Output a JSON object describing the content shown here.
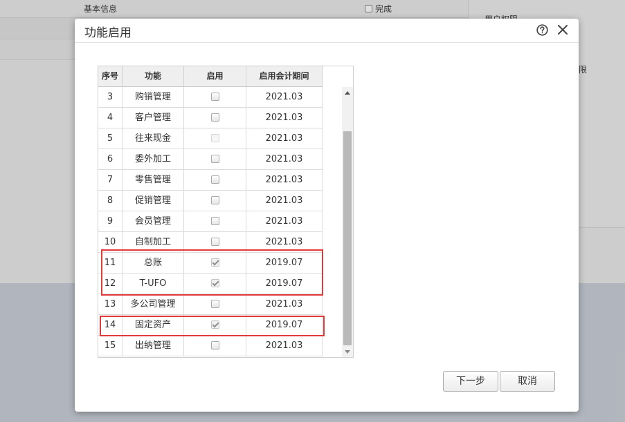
{
  "background": {
    "basic_info_label": "基本信息",
    "done_label": "完成",
    "user_perm_label": "用户权限",
    "fragment_label": "限"
  },
  "dialog": {
    "title": "功能启用",
    "help_icon": "help-circle-icon",
    "close_icon": "close-icon"
  },
  "grid": {
    "columns": [
      "序号",
      "功能",
      "启用",
      "启用会计期间"
    ],
    "rows": [
      {
        "no": "3",
        "function": "购销管理",
        "enabled": false,
        "disabled": false,
        "period": "2021.03"
      },
      {
        "no": "4",
        "function": "客户管理",
        "enabled": false,
        "disabled": false,
        "period": "2021.03"
      },
      {
        "no": "5",
        "function": "往来现金",
        "enabled": false,
        "disabled": true,
        "period": "2021.03"
      },
      {
        "no": "6",
        "function": "委外加工",
        "enabled": false,
        "disabled": false,
        "period": "2021.03"
      },
      {
        "no": "7",
        "function": "零售管理",
        "enabled": false,
        "disabled": false,
        "period": "2021.03"
      },
      {
        "no": "8",
        "function": "促销管理",
        "enabled": false,
        "disabled": false,
        "period": "2021.03"
      },
      {
        "no": "9",
        "function": "会员管理",
        "enabled": false,
        "disabled": false,
        "period": "2021.03"
      },
      {
        "no": "10",
        "function": "自制加工",
        "enabled": false,
        "disabled": false,
        "period": "2021.03"
      },
      {
        "no": "11",
        "function": "总账",
        "enabled": true,
        "disabled": false,
        "period": "2019.07"
      },
      {
        "no": "12",
        "function": "T-UFO",
        "enabled": true,
        "disabled": false,
        "period": "2019.07"
      },
      {
        "no": "13",
        "function": "多公司管理",
        "enabled": false,
        "disabled": false,
        "period": "2021.03"
      },
      {
        "no": "14",
        "function": "固定资产",
        "enabled": true,
        "disabled": false,
        "period": "2019.07"
      },
      {
        "no": "15",
        "function": "出纳管理",
        "enabled": false,
        "disabled": false,
        "period": "2021.03"
      }
    ]
  },
  "buttons": {
    "next": "下一步",
    "cancel": "取消"
  },
  "colors": {
    "highlight": "#e03a3a",
    "header_bg": "#efefef"
  }
}
